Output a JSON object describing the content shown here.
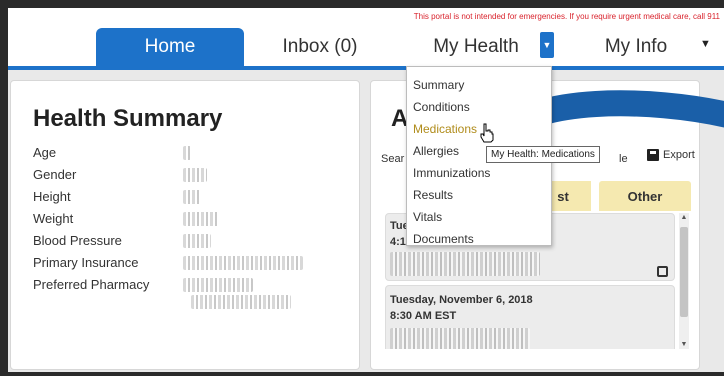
{
  "header": {
    "notice": "This portal is not intended for emergencies. If you require urgent medical care, call 911",
    "tabs": {
      "home": "Home",
      "inbox": "Inbox (0)",
      "my_health": "My Health",
      "my_info": "My Info"
    }
  },
  "dropdown": {
    "items": [
      "Summary",
      "Conditions",
      "Medications",
      "Allergies",
      "Immunizations",
      "Results",
      "Vitals",
      "Documents"
    ],
    "active_index": 2
  },
  "tooltip": "My Health: Medications",
  "health_summary": {
    "title": "Health Summary",
    "fields": [
      "Age",
      "Gender",
      "Height",
      "Weight",
      "Blood Pressure",
      "Primary Insurance",
      "Preferred Pharmacy"
    ]
  },
  "right_panel": {
    "heading_visible": "A",
    "search_partial": "Sear",
    "partial_label": "le",
    "export_label": "Export",
    "tab_partial": "st",
    "tab_other": "Other",
    "appointments": [
      {
        "date_partial": "Tue",
        "time_partial": "4:15"
      },
      {
        "date": "Tuesday, November 6, 2018",
        "time": "8:30 AM EST"
      }
    ]
  },
  "colors": {
    "primary": "#1d72c9",
    "notice": "#d9232d",
    "active_menu": "#b08c1b",
    "tab_yellow": "#f5e9b0"
  }
}
